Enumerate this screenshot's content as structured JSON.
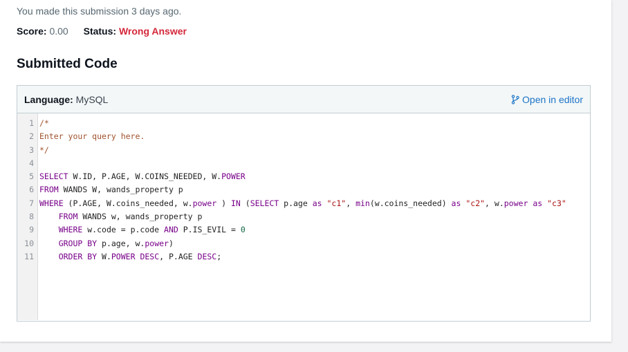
{
  "submission": {
    "note": "You made this submission 3 days ago.",
    "score_label": "Score:",
    "score_value": "0.00",
    "status_label": "Status:",
    "status_value": "Wrong Answer"
  },
  "section_title": "Submitted Code",
  "code_panel": {
    "language_label": "Language:",
    "language_value": "MySQL",
    "open_editor_label": "Open in editor",
    "lines": [
      {
        "n": "1",
        "tokens": [
          [
            "cm",
            "/*"
          ]
        ]
      },
      {
        "n": "2",
        "tokens": [
          [
            "cm",
            "Enter your query here."
          ]
        ]
      },
      {
        "n": "3",
        "tokens": [
          [
            "cm",
            "*/"
          ]
        ]
      },
      {
        "n": "4",
        "tokens": []
      },
      {
        "n": "5",
        "tokens": [
          [
            "kw",
            "SELECT"
          ],
          [
            "",
            " W.ID, P.AGE, W.COINS_NEEDED, W."
          ],
          [
            "kw",
            "POWER"
          ]
        ]
      },
      {
        "n": "6",
        "tokens": [
          [
            "kw",
            "FROM"
          ],
          [
            "",
            " WANDS W, wands_property p"
          ]
        ]
      },
      {
        "n": "7",
        "tokens": [
          [
            "kw",
            "WHERE"
          ],
          [
            "",
            " (P.AGE, W.coins_needed, w."
          ],
          [
            "kw",
            "power"
          ],
          [
            "",
            " ) "
          ],
          [
            "kw",
            "IN"
          ],
          [
            "",
            " ("
          ],
          [
            "kw",
            "SELECT"
          ],
          [
            "",
            " p.age "
          ],
          [
            "kw",
            "as"
          ],
          [
            "",
            " "
          ],
          [
            "str",
            "\"c1\""
          ],
          [
            "",
            ", "
          ],
          [
            "fn",
            "min"
          ],
          [
            "",
            "(w.coins_needed) "
          ],
          [
            "kw",
            "as"
          ],
          [
            "",
            " "
          ],
          [
            "str",
            "\"c2\""
          ],
          [
            "",
            ", w."
          ],
          [
            "kw",
            "power"
          ],
          [
            "",
            " "
          ],
          [
            "kw",
            "as"
          ],
          [
            "",
            " "
          ],
          [
            "str",
            "\"c3\""
          ]
        ]
      },
      {
        "n": "8",
        "tokens": [
          [
            "",
            "    "
          ],
          [
            "kw",
            "FROM"
          ],
          [
            "",
            " WANDS w, wands_property p"
          ]
        ]
      },
      {
        "n": "9",
        "tokens": [
          [
            "",
            "    "
          ],
          [
            "kw",
            "WHERE"
          ],
          [
            "",
            " w.code = p.code "
          ],
          [
            "kw",
            "AND"
          ],
          [
            "",
            " P.IS_EVIL = "
          ],
          [
            "num",
            "0"
          ]
        ]
      },
      {
        "n": "10",
        "tokens": [
          [
            "",
            "    "
          ],
          [
            "kw",
            "GROUP BY"
          ],
          [
            "",
            " p.age, w."
          ],
          [
            "kw",
            "power"
          ],
          [
            "",
            ")"
          ]
        ]
      },
      {
        "n": "11",
        "tokens": [
          [
            "",
            "    "
          ],
          [
            "kw",
            "ORDER BY"
          ],
          [
            "",
            " W."
          ],
          [
            "kw",
            "POWER"
          ],
          [
            "",
            " "
          ],
          [
            "kw",
            "DESC"
          ],
          [
            "",
            ", P.AGE "
          ],
          [
            "kw",
            "DESC"
          ],
          [
            "",
            ";"
          ]
        ]
      }
    ]
  },
  "colors": {
    "status_wrong": "#d4273a",
    "link": "#1a73c8",
    "keyword": "#770088",
    "comment": "#a0522d",
    "string": "#aa1111",
    "number": "#116644"
  },
  "icons": {
    "open_editor": "branch-icon"
  }
}
